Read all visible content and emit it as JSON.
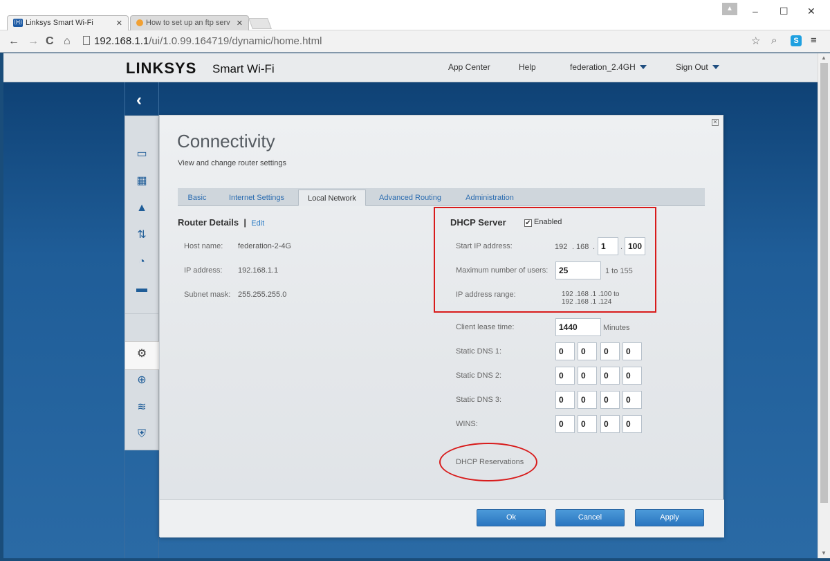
{
  "browser": {
    "tabs": [
      {
        "label": "Linksys Smart Wi-Fi",
        "favicon": "((•))"
      },
      {
        "label": "How to set up an ftp serv"
      }
    ],
    "url_host": "192.168.1.1",
    "url_path": "/ui/1.0.99.164719/dynamic/home.html",
    "window_controls": {
      "minimize": "–",
      "maximize": "☐",
      "close": "✕"
    },
    "nav": {
      "back": "←",
      "forward": "→",
      "reload": "C",
      "home": "⌂"
    },
    "right_icons": {
      "star": "☆",
      "search": "⌕",
      "skype": "S",
      "menu": "≡"
    }
  },
  "header": {
    "logo": "LINKSYS",
    "logo_sub": "Smart Wi-Fi",
    "links": {
      "app_center": "App Center",
      "help": "Help",
      "network": "federation_2.4GH",
      "sign_out": "Sign Out"
    }
  },
  "sidebar": {
    "back": "‹",
    "icons": [
      "devices-icon",
      "parental-controls-icon",
      "guest-access-icon",
      "media-prioritization-icon",
      "speed-test-icon",
      "external-storage-icon",
      "connectivity-icon",
      "troubleshooting-icon",
      "wireless-icon",
      "security-icon"
    ]
  },
  "dialog": {
    "title": "Connectivity",
    "subtitle": "View and change router settings",
    "close": "✕",
    "tabs": [
      "Basic",
      "Internet Settings",
      "Local Network",
      "Advanced Routing",
      "Administration"
    ],
    "selected_tab": "Local Network",
    "router_details": {
      "heading": "Router Details",
      "separator": "|",
      "edit": "Edit",
      "host_name_label": "Host name:",
      "host_name": "federation-2-4G",
      "ip_label": "IP address:",
      "ip": "192.168.1.1",
      "subnet_label": "Subnet mask:",
      "subnet": "255.255.255.0"
    },
    "dhcp": {
      "heading": "DHCP Server",
      "enabled_label": "Enabled",
      "enabled_check": "✔",
      "start_ip_label": "Start IP address:",
      "start_ip_prefix_1": "192",
      "start_ip_prefix_2": "168",
      "dot": ".",
      "start_ip_octet3": "1",
      "start_ip_octet4": "100",
      "max_users_label": "Maximum number of users:",
      "max_users": "25",
      "max_users_range": "1 to 155",
      "ip_range_label": "IP address range:",
      "ip_range_from": "192 .168 .1 .100  to",
      "ip_range_to": "192 .168 .1 .124",
      "lease_label": "Client lease time:",
      "lease": "1440",
      "lease_unit": "Minutes",
      "dns1_label": "Static DNS 1:",
      "dns1": [
        "0",
        "0",
        "0",
        "0"
      ],
      "dns2_label": "Static DNS 2:",
      "dns2": [
        "0",
        "0",
        "0",
        "0"
      ],
      "dns3_label": "Static DNS 3:",
      "dns3": [
        "0",
        "0",
        "0",
        "0"
      ],
      "wins_label": "WINS:",
      "wins": [
        "0",
        "0",
        "0",
        "0"
      ],
      "reservations_link": "DHCP Reservations"
    },
    "footer": {
      "ok": "Ok",
      "cancel": "Cancel",
      "apply": "Apply"
    }
  },
  "colors": {
    "accent_blue": "#2b7bc4",
    "highlight_red": "#d81b1b",
    "page_bg": "#1f5d98"
  }
}
